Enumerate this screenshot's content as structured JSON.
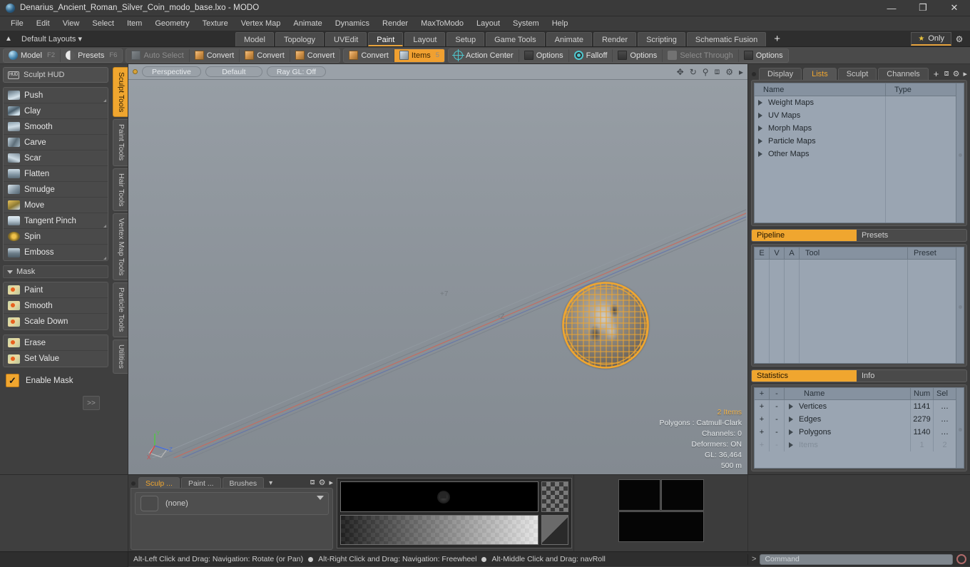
{
  "window": {
    "title": "Denarius_Ancient_Roman_Silver_Coin_modo_base.lxo - MODO",
    "minimize": "—",
    "maximize": "❐",
    "close": "✕"
  },
  "menu": {
    "items": [
      "File",
      "Edit",
      "View",
      "Select",
      "Item",
      "Geometry",
      "Texture",
      "Vertex Map",
      "Animate",
      "Dynamics",
      "Render",
      "MaxToModo",
      "Layout",
      "System",
      "Help"
    ]
  },
  "layout_row": {
    "default_layouts": "Default Layouts",
    "dropdown_caret": "▾",
    "tabs": [
      {
        "label": "Model",
        "active": false
      },
      {
        "label": "Topology",
        "active": false
      },
      {
        "label": "UVEdit",
        "active": false
      },
      {
        "label": "Paint",
        "active": true
      },
      {
        "label": "Layout",
        "active": false
      },
      {
        "label": "Setup",
        "active": false
      },
      {
        "label": "Game Tools",
        "active": false
      },
      {
        "label": "Animate",
        "active": false
      },
      {
        "label": "Render",
        "active": false
      },
      {
        "label": "Scripting",
        "active": false
      },
      {
        "label": "Schematic Fusion",
        "active": false
      }
    ],
    "add_tab": "+",
    "only_label": "Only",
    "star": "★",
    "gear": "⚙"
  },
  "toolbar": {
    "mode_group": [
      {
        "label": "Model",
        "key": "F2",
        "icon": "sphere-icon"
      },
      {
        "label": "Presets",
        "key": "F6",
        "icon": "preset-icon"
      }
    ],
    "select_group": [
      {
        "label": "Auto Select",
        "dim": true,
        "icon": "cube-grey-icon"
      },
      {
        "label": "Convert",
        "dim": false,
        "icon": "cube-orange-icon"
      },
      {
        "label": "Convert",
        "dim": false,
        "icon": "cube-orange-icon"
      },
      {
        "label": "Convert",
        "dim": false,
        "icon": "cube-orange-icon"
      }
    ],
    "items_group": [
      {
        "label": "Convert",
        "selected": false,
        "icon": "cube-orange-icon"
      },
      {
        "label": "Items",
        "selected": true,
        "key": "5",
        "icon": "cube-blue-icon"
      }
    ],
    "action_group": [
      {
        "label": "Action Center",
        "icon": "action-center-icon",
        "dim": false
      },
      {
        "label": "Options",
        "icon": "options-icon",
        "dim": false
      },
      {
        "label": "Falloff",
        "icon": "falloff-icon",
        "dim": false
      },
      {
        "label": "Options",
        "icon": "options-icon",
        "dim": false
      },
      {
        "label": "Select Through",
        "icon": "select-through-icon",
        "dim": true
      },
      {
        "label": "Options",
        "icon": "options-icon",
        "dim": false
      }
    ]
  },
  "sculpt_panel": {
    "hud": "Sculpt HUD",
    "tools": [
      {
        "label": "Push",
        "brush": "br-push",
        "corner": true
      },
      {
        "label": "Clay",
        "brush": "br-clay",
        "corner": false
      },
      {
        "label": "Smooth",
        "brush": "br-smooth",
        "corner": false
      },
      {
        "label": "Carve",
        "brush": "br-carve",
        "corner": false
      },
      {
        "label": "Scar",
        "brush": "br-scar",
        "corner": false
      },
      {
        "label": "Flatten",
        "brush": "br-flatten",
        "corner": false
      },
      {
        "label": "Smudge",
        "brush": "br-smudge",
        "corner": false
      },
      {
        "label": "Move",
        "brush": "br-move",
        "corner": false
      },
      {
        "label": "Tangent Pinch",
        "brush": "br-pinch",
        "corner": true
      },
      {
        "label": "Spin",
        "brush": "br-spin",
        "corner": false
      },
      {
        "label": "Emboss",
        "brush": "br-emboss",
        "corner": true
      }
    ],
    "mask_header": "Mask",
    "mask_tools": [
      {
        "label": "Paint",
        "brush": "br-mask"
      },
      {
        "label": "Smooth",
        "brush": "br-mask"
      },
      {
        "label": "Scale Down",
        "brush": "br-mask"
      }
    ],
    "mask_tools2": [
      {
        "label": "Erase",
        "brush": "br-mask"
      },
      {
        "label": "Set Value",
        "brush": "br-mask"
      }
    ],
    "enable_mask": "Enable Mask",
    "enable_mask_checked": "✓",
    "expand": ">>"
  },
  "vertical_tabs": [
    {
      "label": "Sculpt Tools",
      "active": true
    },
    {
      "label": "Paint Tools",
      "active": false
    },
    {
      "label": "Hair Tools",
      "active": false
    },
    {
      "label": "Vertex Map Tools",
      "active": false
    },
    {
      "label": "Particle Tools",
      "active": false
    },
    {
      "label": "Utilities",
      "active": false
    }
  ],
  "viewport": {
    "projection": "Perspective",
    "shading": "Default",
    "raygl": "Ray GL: Off",
    "icons": [
      "move-icon",
      "rotate-icon",
      "zoom-icon",
      "expand-icon",
      "gear-icon",
      "chevron-right-icon"
    ],
    "axis_label_plus": "+7",
    "axis_label_minus": "-Z",
    "stats": {
      "items": "2 Items",
      "polygons": "Polygons : Catmull-Clark",
      "channels": "Channels: 0",
      "deformers": "Deformers: ON",
      "gl": "GL: 36,464",
      "scale": "500 m"
    },
    "wire_color": "#f0a62f"
  },
  "right_panel": {
    "tabs": [
      {
        "label": "Display",
        "active": false
      },
      {
        "label": "Lists",
        "active": true
      },
      {
        "label": "Sculpt",
        "active": false
      },
      {
        "label": "Channels",
        "active": false
      }
    ],
    "add_tab": "+",
    "icons": [
      "expand-icon",
      "gear-icon",
      "chevron-right-icon"
    ],
    "lists": {
      "columns": [
        "Name",
        "Type"
      ],
      "rows": [
        {
          "name": "Weight Maps",
          "type": ""
        },
        {
          "name": "UV Maps",
          "type": ""
        },
        {
          "name": "Morph Maps",
          "type": ""
        },
        {
          "name": "Particle Maps",
          "type": ""
        },
        {
          "name": "Other Maps",
          "type": ""
        }
      ]
    },
    "pipeline": {
      "tabs": [
        {
          "label": "Pipeline",
          "active": true
        },
        {
          "label": "Presets",
          "active": false
        }
      ],
      "columns": [
        "E",
        "V",
        "A",
        "Tool",
        "Preset"
      ],
      "rows": []
    },
    "statistics": {
      "tabs": [
        {
          "label": "Statistics",
          "active": true
        },
        {
          "label": "Info",
          "active": false
        }
      ],
      "columns": [
        "+",
        "-",
        "Name",
        "Num",
        "Sel"
      ],
      "rows": [
        {
          "plus": "+",
          "minus": "-",
          "name": "Vertices",
          "num": "1141",
          "sel": "…",
          "dim": false
        },
        {
          "plus": "+",
          "minus": "-",
          "name": "Edges",
          "num": "2279",
          "sel": "…",
          "dim": false
        },
        {
          "plus": "+",
          "minus": "-",
          "name": "Polygons",
          "num": "1140",
          "sel": "…",
          "dim": false
        },
        {
          "plus": "+",
          "minus": "-",
          "name": "Items",
          "num": "1",
          "sel": "2",
          "dim": true
        }
      ]
    }
  },
  "bottom_panel": {
    "tabs": [
      {
        "label": "Sculp ...",
        "active": true
      },
      {
        "label": "Paint ...",
        "active": false
      },
      {
        "label": "Brushes",
        "active": false
      }
    ],
    "dropdown_caret": "▾",
    "icons": [
      "expand-icon",
      "gear-icon",
      "chevron-right-icon"
    ],
    "selected_value": "(none)"
  },
  "status_bar": {
    "hints": [
      "Alt-Left Click and Drag: Navigation: Rotate (or Pan)",
      "Alt-Right Click and Drag: Navigation: Freewheel",
      "Alt-Middle Click and Drag: navRoll"
    ],
    "command_prompt": ">",
    "command_placeholder": "Command"
  },
  "colors": {
    "accent": "#f0a62f",
    "panel": "#4a4a4a",
    "viewport_bg": "#8d949b",
    "list_bg": "#9aa5b2"
  }
}
